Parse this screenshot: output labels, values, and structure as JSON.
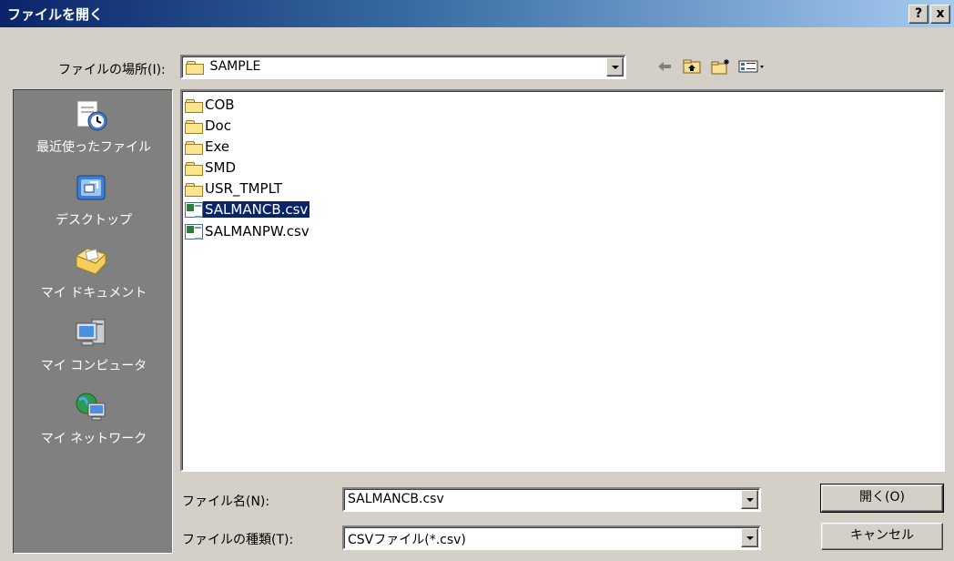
{
  "window": {
    "title": "ファイルを開く",
    "help_label": "?",
    "close_label": "x"
  },
  "lookin": {
    "label": "ファイルの場所(I):",
    "value": "SAMPLE"
  },
  "toolbar": {
    "back_icon": "back-arrow-icon",
    "up_icon": "up-folder-icon",
    "new_folder_icon": "new-folder-icon",
    "view_icon": "view-menu-icon"
  },
  "places": [
    {
      "label": "最近使ったファイル",
      "icon": "recent-files-icon"
    },
    {
      "label": "デスクトップ",
      "icon": "desktop-icon"
    },
    {
      "label": "マイ ドキュメント",
      "icon": "my-documents-icon"
    },
    {
      "label": "マイ コンピュータ",
      "icon": "my-computer-icon"
    },
    {
      "label": "マイ ネットワーク",
      "icon": "my-network-icon"
    }
  ],
  "files": [
    {
      "name": "COB",
      "type": "folder"
    },
    {
      "name": "Doc",
      "type": "folder"
    },
    {
      "name": "Exe",
      "type": "folder"
    },
    {
      "name": "SMD",
      "type": "folder"
    },
    {
      "name": "USR_TMPLT",
      "type": "folder"
    },
    {
      "name": "SALMANCB.csv",
      "type": "csv",
      "selected": true
    },
    {
      "name": "SALMANPW.csv",
      "type": "csv"
    }
  ],
  "filename": {
    "label": "ファイル名(N):",
    "value": "SALMANCB.csv"
  },
  "filetype": {
    "label": "ファイルの種類(T):",
    "value": "CSVファイル(*.csv)"
  },
  "buttons": {
    "open": "開く(O)",
    "cancel": "キャンセル"
  },
  "colors": {
    "selection": "#0a246a",
    "titlebar_start": "#0a246a",
    "titlebar_end": "#a6caf0",
    "face": "#d4d0c8"
  }
}
